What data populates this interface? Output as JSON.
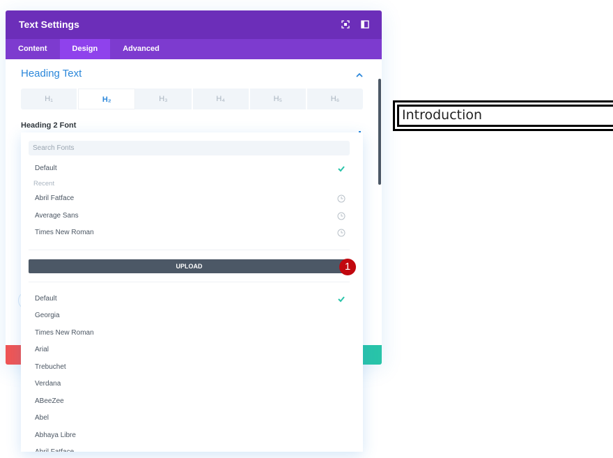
{
  "modal": {
    "title": "Text Settings",
    "header_icons": [
      "screenshot-icon",
      "sidebar-toggle-icon"
    ],
    "tabs": [
      {
        "label": "Content",
        "active": false
      },
      {
        "label": "Design",
        "active": true
      },
      {
        "label": "Advanced",
        "active": false
      }
    ],
    "section_title": "Heading Text",
    "heading_tabs": [
      {
        "label": "H₁",
        "active": false
      },
      {
        "label": "H₂",
        "active": true
      },
      {
        "label": "H₃",
        "active": false
      },
      {
        "label": "H₄",
        "active": false
      },
      {
        "label": "H₅",
        "active": false
      },
      {
        "label": "H₆",
        "active": false
      }
    ],
    "field_label": "Heading 2 Font"
  },
  "font_dropdown": {
    "search_placeholder": "Search Fonts",
    "selected": "Default",
    "top_default": "Default",
    "recent_label": "Recent",
    "recent": [
      "Abril Fatface",
      "Average Sans",
      "Times New Roman"
    ],
    "upload_label": "UPLOAD",
    "badge": "1",
    "fonts": [
      "Default",
      "Georgia",
      "Times New Roman",
      "Arial",
      "Trebuchet",
      "Verdana",
      "ABeeZee",
      "Abel",
      "Abhaya Libre",
      "Abril Fatface"
    ]
  },
  "preview": {
    "text": "Introduction"
  },
  "colors": {
    "header": "#6c2eb9",
    "tabs": "#7d3bcf",
    "tab_active": "#8f42ec",
    "accent": "#2b87da",
    "check": "#29c4a9",
    "danger": "#ef5555",
    "success": "#29c4a9",
    "upload": "#4c5866",
    "badge": "#c1080f"
  }
}
